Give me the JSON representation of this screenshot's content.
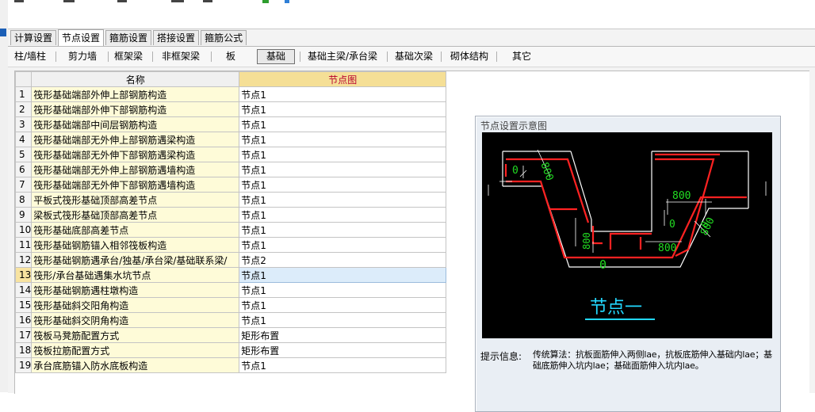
{
  "tabs": [
    "计算设置",
    "节点设置",
    "箍筋设置",
    "搭接设置",
    "箍筋公式"
  ],
  "active_tab_index": 1,
  "categories": [
    "柱/墙柱",
    "剪力墙",
    "框架梁",
    "非框架梁",
    "板",
    "基础",
    "基础主梁/承台梁",
    "基础次梁",
    "砌体结构",
    "其它"
  ],
  "active_category_index": 5,
  "grid": {
    "col_name": "名称",
    "col_value": "节点图",
    "rows": [
      {
        "num": "1",
        "name": "筏形基础端部外伸上部钢筋构造",
        "value": "节点1"
      },
      {
        "num": "2",
        "name": "筏形基础端部外伸下部钢筋构造",
        "value": "节点1"
      },
      {
        "num": "3",
        "name": "筏形基础端部中间层钢筋构造",
        "value": "节点1"
      },
      {
        "num": "4",
        "name": "筏形基础端部无外伸上部钢筋遇梁构造",
        "value": "节点1"
      },
      {
        "num": "5",
        "name": "筏形基础端部无外伸下部钢筋遇梁构造",
        "value": "节点1"
      },
      {
        "num": "6",
        "name": "筏形基础端部无外伸上部钢筋遇墙构造",
        "value": "节点1"
      },
      {
        "num": "7",
        "name": "筏形基础端部无外伸下部钢筋遇墙构造",
        "value": "节点1"
      },
      {
        "num": "8",
        "name": "平板式筏形基础顶部高差节点",
        "value": "节点1"
      },
      {
        "num": "9",
        "name": "梁板式筏形基础顶部高差节点",
        "value": "节点1"
      },
      {
        "num": "10",
        "name": "筏形基础底部高差节点",
        "value": "节点1"
      },
      {
        "num": "11",
        "name": "筏形基础钢筋锚入相邻筏板构造",
        "value": "节点1"
      },
      {
        "num": "12",
        "name": "筏形基础钢筋遇承台/独基/承台梁/基础联系梁/",
        "value": "节点2"
      },
      {
        "num": "13",
        "name": "筏形/承台基础遇集水坑节点",
        "value": "节点1"
      },
      {
        "num": "14",
        "name": "筏形基础钢筋遇柱墩构造",
        "value": "节点1"
      },
      {
        "num": "15",
        "name": "筏形基础斜交阳角构造",
        "value": "节点1"
      },
      {
        "num": "16",
        "name": "筏形基础斜交阴角构造",
        "value": "节点1"
      },
      {
        "num": "17",
        "name": "筏板马凳筋配置方式",
        "value": "矩形布置"
      },
      {
        "num": "18",
        "name": "筏板拉筋配置方式",
        "value": "矩形布置"
      },
      {
        "num": "19",
        "name": "承台底筋锚入防水底板构造",
        "value": "节点1"
      }
    ],
    "selected_row_index": 12
  },
  "diagram": {
    "title": "节点设置示意图",
    "node_caption": "节点一",
    "dims": {
      "d800_a": "800",
      "d800_b": "800",
      "d800_c": "800",
      "d800_d": "800",
      "d800_e": "800",
      "z1": "0",
      "z2": "0",
      "z3": "0",
      "z4": "0"
    },
    "hint_label": "提示信息:",
    "hint_text": "传统算法：抗板面筋伸入两侧lae，抗板底筋伸入基础内lae；基础底筋伸入坑内lae；基础面筋伸入坑内lae。"
  },
  "colors": {
    "selected_row": "#dcecfa",
    "name_cell": "#fefbd8",
    "header_highlight": "#f5df96",
    "canvas_bg": "#000000",
    "rebar_red": "#ff2222",
    "dim_green": "#22dd22",
    "caption_cyan": "#22d8ff"
  }
}
